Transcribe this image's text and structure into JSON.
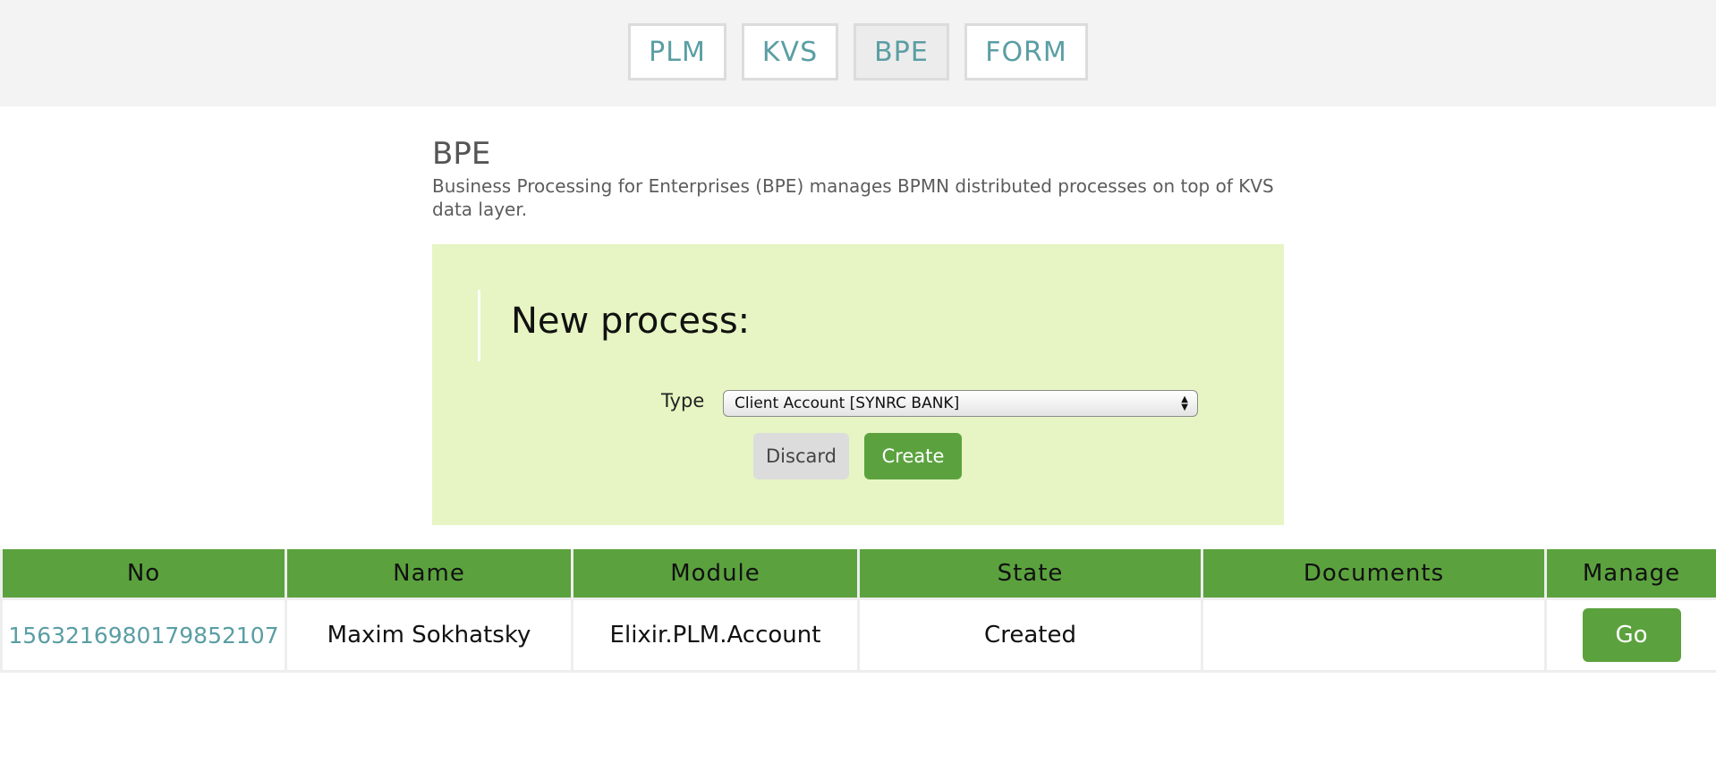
{
  "nav": {
    "tabs": [
      {
        "label": "PLM"
      },
      {
        "label": "KVS"
      },
      {
        "label": "BPE"
      },
      {
        "label": "FORM"
      }
    ]
  },
  "page": {
    "title": "BPE",
    "description": "Business Processing for Enterprises (BPE) manages BPMN distributed processes on top of KVS data layer."
  },
  "new_process": {
    "heading": "New process:",
    "type_label": "Type",
    "type_selected": "Client Account [SYNRC BANK]",
    "discard_label": "Discard",
    "create_label": "Create"
  },
  "table": {
    "columns": [
      "No",
      "Name",
      "Module",
      "State",
      "Documents",
      "Manage"
    ],
    "rows": [
      {
        "no": "1563216980179852107",
        "name": "Maxim Sokhatsky",
        "module": "Elixir.PLM.Account",
        "state": "Created",
        "documents": "",
        "manage": "Go"
      }
    ]
  },
  "colors": {
    "accent_green": "#5ba23e",
    "panel_green": "#e6f5c3",
    "link_teal": "#5a9ea3"
  },
  "icons": {
    "select_arrows": "chevron-up-down-icon"
  }
}
